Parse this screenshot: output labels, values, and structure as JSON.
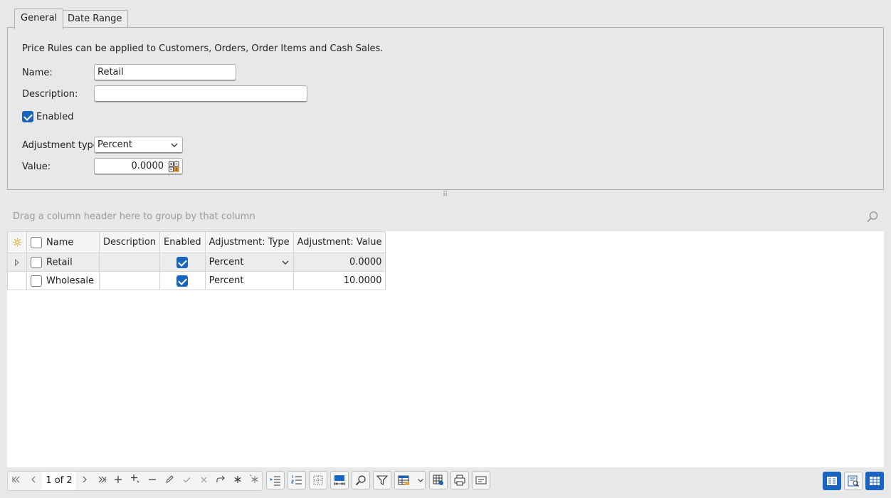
{
  "tabs": [
    {
      "label": "General"
    },
    {
      "label": "Date Range"
    }
  ],
  "general": {
    "intro": "Price Rules can be applied to Customers, Orders, Order Items and Cash Sales.",
    "name_label": "Name:",
    "name_value": "Retail",
    "description_label": "Description:",
    "description_value": "",
    "enabled_label": "Enabled",
    "enabled_checked": true,
    "adjustment_type_label": "Adjustment type:",
    "adjustment_type_value": "Percent",
    "value_label": "Value:",
    "value_value": "0.0000"
  },
  "grid": {
    "group_hint": "Drag a column header here to group by that column",
    "columns": [
      "Name",
      "Description",
      "Enabled",
      "Adjustment: Type",
      "Adjustment: Value"
    ],
    "rows": [
      {
        "name": "Retail",
        "description": "",
        "enabled": true,
        "type": "Percent",
        "value": "0.0000"
      },
      {
        "name": "Wholesale",
        "description": "",
        "enabled": true,
        "type": "Percent",
        "value": "10.0000"
      }
    ]
  },
  "navigator": {
    "page_text": "1 of 2"
  },
  "colors": {
    "accent": "#1865c1",
    "background": "#e8e8e8"
  }
}
